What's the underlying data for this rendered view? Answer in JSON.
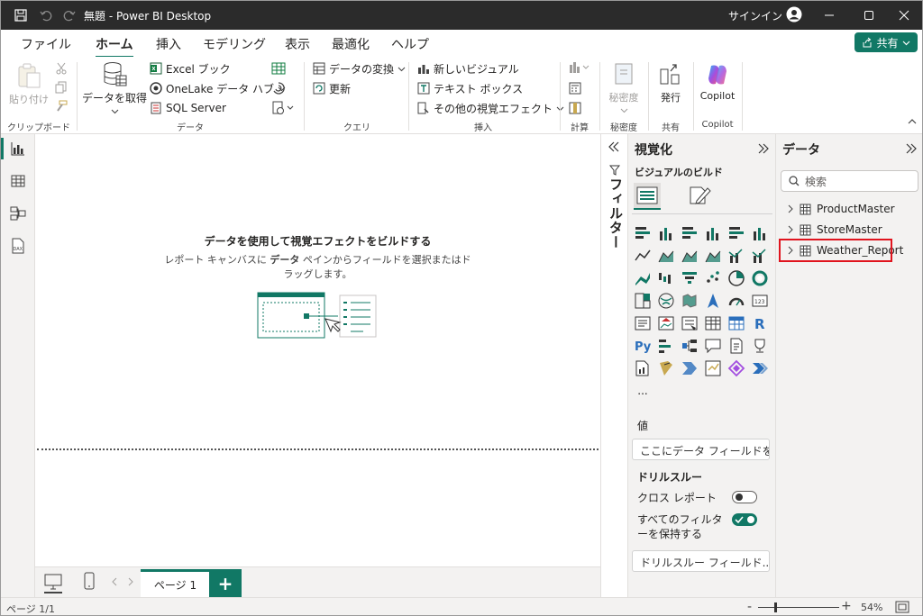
{
  "window": {
    "title": "無題 - Power BI Desktop",
    "signin": "サインイン",
    "icons": [
      "save-icon",
      "undo-icon",
      "redo-icon"
    ]
  },
  "menu": {
    "tabs": [
      "ファイル",
      "ホーム",
      "挿入",
      "モデリング",
      "表示",
      "最適化",
      "ヘルプ"
    ],
    "active": "ホーム",
    "share_label": "共有"
  },
  "ribbon": {
    "clipboard": {
      "paste": "貼り付け",
      "label": "クリップボード"
    },
    "data": {
      "get_data": "データを取得",
      "excel": "Excel ブック",
      "onelake": "OneLake データ ハブ",
      "sql": "SQL Server",
      "label": "データ"
    },
    "query": {
      "transform": "データの変換",
      "refresh": "更新",
      "label": "クエリ"
    },
    "insert": {
      "new_visual": "新しいビジュアル",
      "text_box": "テキスト ボックス",
      "more_visuals": "その他の視覚エフェクト",
      "label": "挿入"
    },
    "calc": {
      "label": "計算"
    },
    "sensitivity": {
      "btn": "秘密度",
      "label": "秘密度"
    },
    "publish": {
      "btn": "発行",
      "label": "共有"
    },
    "copilot": {
      "btn": "Copilot",
      "label": "Copilot"
    }
  },
  "canvas": {
    "heading": "データを使用して視覚エフェクトをビルドする",
    "sub_before": "レポート キャンバスに ",
    "sub_bold": "データ",
    "sub_after": " ペインからフィールドを選択またはドラッグします。"
  },
  "pages": {
    "tab": "ページ 1",
    "add": "+"
  },
  "filters": {
    "label": "フィルター"
  },
  "viz": {
    "title": "視覚化",
    "build": "ビジュアルのビルド",
    "values_label": "値",
    "values_placeholder": "ここにデータ フィールドを...",
    "drillthrough": "ドリルスルー",
    "cross_report": "クロス レポート",
    "keep_filters": "すべてのフィルターを保持する",
    "drill_placeholder": "ドリルスルー フィールド...",
    "more": "..."
  },
  "data_pane": {
    "title": "データ",
    "search_placeholder": "検索",
    "tables": [
      "ProductMaster",
      "StoreMaster",
      "Weather_Report"
    ]
  },
  "status": {
    "page": "ページ 1/1",
    "zoom": "54%"
  },
  "colors": {
    "accent": "#117865",
    "highlight": "#e0141e",
    "titlebar": "#2b2b2b"
  }
}
